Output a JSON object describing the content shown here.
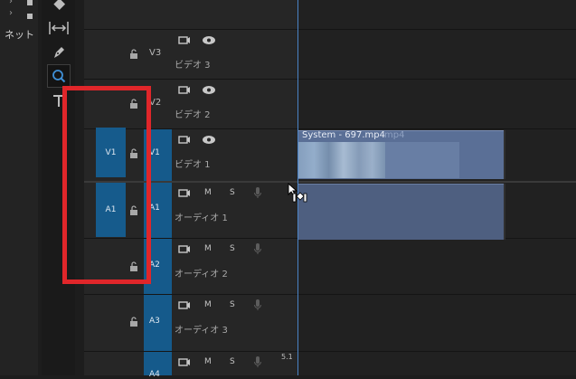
{
  "project_panel": {
    "folder_label": "ネット"
  },
  "tools": {
    "items": [
      "razor-tool",
      "slip-tool",
      "pen-tool",
      "zoom-tool",
      "type-tool"
    ],
    "selected": "zoom-tool"
  },
  "tracks": {
    "video": [
      {
        "id": "V3",
        "name": "ビデオ 3"
      },
      {
        "id": "V2",
        "name": "ビデオ 2"
      },
      {
        "id": "V1",
        "name": "ビデオ 1",
        "source_patch": "V1"
      }
    ],
    "audio": [
      {
        "id": "A1",
        "name": "オーディオ 1",
        "source_patch": "A1",
        "m": "M",
        "s": "S"
      },
      {
        "id": "A2",
        "name": "オーディオ 2",
        "m": "M",
        "s": "S"
      },
      {
        "id": "A3",
        "name": "オーディオ 3",
        "m": "M",
        "s": "S"
      },
      {
        "id": "A4",
        "m": "M",
        "s": "S",
        "channel_label": "5.1"
      }
    ]
  },
  "clips": {
    "video_name": "System - 697.mp4",
    "video_ghost": "mp4"
  },
  "colors": {
    "accent": "#165b8c",
    "highlight": "#e0262a",
    "video_clip": "#5a6f96",
    "audio_clip": "#4e5f80",
    "playhead": "#4a83c6"
  }
}
